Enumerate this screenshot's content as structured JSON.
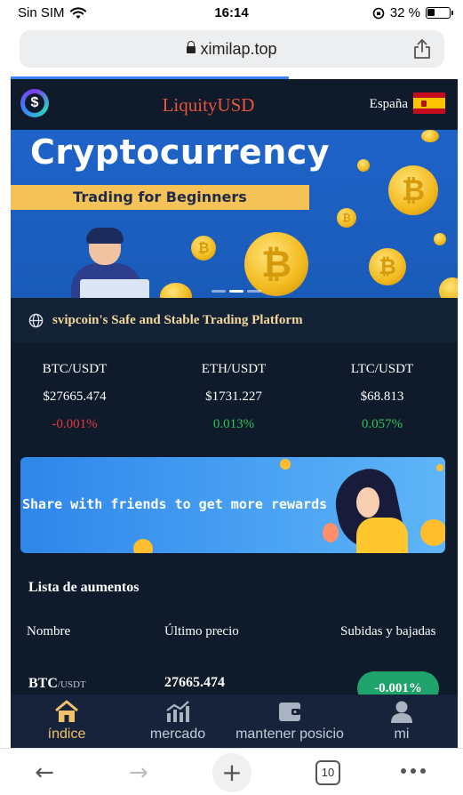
{
  "status_bar": {
    "carrier": "Sin SIM",
    "time": "16:14",
    "battery_percent": "32 %",
    "battery_level": 0.32,
    "icons": [
      "wifi-icon",
      "orientation-lock-icon",
      "battery-icon"
    ]
  },
  "browser": {
    "url": "ximilap.top",
    "tab_count": "10",
    "load_progress": 0.6,
    "icons": [
      "lock-icon",
      "share-icon",
      "back-icon",
      "forward-icon",
      "new-tab-icon",
      "tabs-icon",
      "more-icon"
    ]
  },
  "header": {
    "brand": "LiquityUSD",
    "logo_glyph": "$",
    "language": "España",
    "flag": "spain-flag-icon"
  },
  "hero": {
    "title": "Cryptocurrency",
    "subtitle": "Trading for Beginners",
    "coin_glyph": "₿",
    "slides": 3,
    "active_slide": 1
  },
  "platform": {
    "text": "svipcoin's Safe and Stable Trading Platform",
    "icon": "globe-icon"
  },
  "tickers": [
    {
      "pair": "BTC/USDT",
      "price": "$27665.474",
      "change": "-0.001%",
      "direction": "down"
    },
    {
      "pair": "ETH/USDT",
      "price": "$1731.227",
      "change": "0.013%",
      "direction": "up"
    },
    {
      "pair": "LTC/USDT",
      "price": "$68.813",
      "change": "0.057%",
      "direction": "up"
    }
  ],
  "share_banner": {
    "text": "Share with friends to get more rewards"
  },
  "list": {
    "title": "Lista de aumentos",
    "columns": [
      "Nombre",
      "Último precio",
      "Subidas y bajadas"
    ],
    "rows": [
      {
        "symbol": "BTC",
        "quote": "/USDT",
        "price": "27665.474",
        "change": "-0.001%"
      }
    ]
  },
  "bottom_nav": [
    {
      "label": "índice",
      "icon": "home-icon",
      "active": true
    },
    {
      "label": "mercado",
      "icon": "chart-icon",
      "active": false
    },
    {
      "label": "mantener posicio",
      "icon": "wallet-icon",
      "active": false
    },
    {
      "label": "mi",
      "icon": "user-icon",
      "active": false
    }
  ],
  "colors": {
    "app_background": "#0f1a2b",
    "brand": "#e8563a",
    "accent_gold": "#f0c36a",
    "positive": "#2ec458",
    "negative": "#e03c3c",
    "change_pill": "#1fa36a"
  }
}
